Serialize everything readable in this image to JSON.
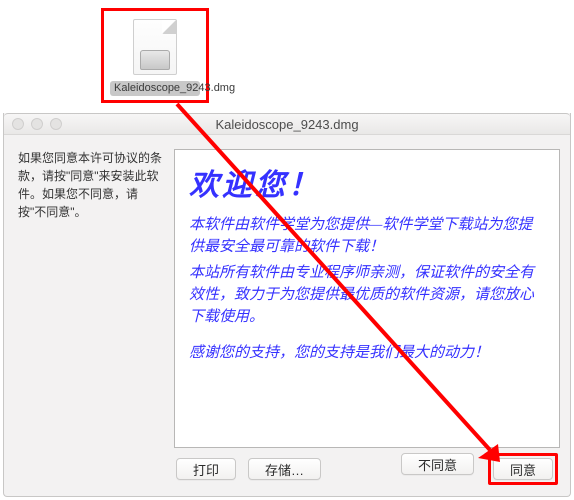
{
  "file": {
    "label": "Kaleidoscope_9243.dmg"
  },
  "dialog": {
    "title": "Kaleidoscope_9243.dmg",
    "sidebar_text": "如果您同意本许可协议的条款，请按\"同意\"来安装此软件。如果您不同意，请按\"不同意\"。",
    "content": {
      "heading": "欢迎您！",
      "p1": "本软件由软件学堂为您提供—软件学堂下载站为您提供最安全最可靠的软件下载！",
      "p2": "本站所有软件由专业程序师亲测，保证软件的安全有效性，致力于为您提供最优质的软件资源，请您放心下载使用。",
      "p3": "感谢您的支持，您的支持是我们最大的动力！"
    },
    "buttons": {
      "print": "打印",
      "save": "存储…",
      "disagree": "不同意",
      "agree": "同意"
    }
  }
}
